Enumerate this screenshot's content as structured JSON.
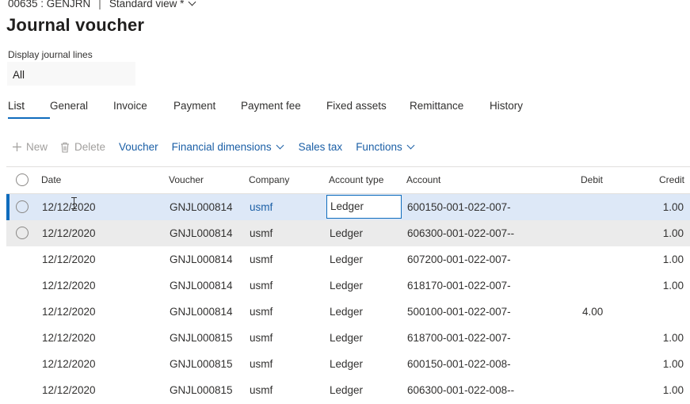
{
  "header": {
    "record": "00635 : GENJRN",
    "separator": "|",
    "view_label": "Standard view *",
    "title": "Journal voucher"
  },
  "filter": {
    "label": "Display journal lines",
    "value": "All"
  },
  "tabs": [
    {
      "label": "List",
      "active": true
    },
    {
      "label": "General"
    },
    {
      "label": "Invoice"
    },
    {
      "label": "Payment"
    },
    {
      "label": "Payment fee"
    },
    {
      "label": "Fixed assets"
    },
    {
      "label": "Remittance"
    },
    {
      "label": "History"
    }
  ],
  "toolbar": {
    "new_label": "New",
    "delete_label": "Delete",
    "voucher_label": "Voucher",
    "financial_dimensions_label": "Financial dimensions",
    "sales_tax_label": "Sales tax",
    "functions_label": "Functions"
  },
  "grid": {
    "columns": {
      "date": "Date",
      "voucher": "Voucher",
      "company": "Company",
      "account_type": "Account type",
      "account": "Account",
      "debit": "Debit",
      "credit": "Credit"
    },
    "rows": [
      {
        "date": "12/12/2020",
        "voucher": "GNJL000814",
        "company": "usmf",
        "account_type": "Ledger",
        "account": "600150-001-022-007-",
        "debit": "",
        "credit": "1.00"
      },
      {
        "date": "12/12/2020",
        "voucher": "GNJL000814",
        "company": "usmf",
        "account_type": "Ledger",
        "account": "606300-001-022-007--",
        "debit": "",
        "credit": "1.00"
      },
      {
        "date": "12/12/2020",
        "voucher": "GNJL000814",
        "company": "usmf",
        "account_type": "Ledger",
        "account": "607200-001-022-007-",
        "debit": "",
        "credit": "1.00"
      },
      {
        "date": "12/12/2020",
        "voucher": "GNJL000814",
        "company": "usmf",
        "account_type": "Ledger",
        "account": "618170-001-022-007-",
        "debit": "",
        "credit": "1.00"
      },
      {
        "date": "12/12/2020",
        "voucher": "GNJL000814",
        "company": "usmf",
        "account_type": "Ledger",
        "account": "500100-001-022-007-",
        "debit": "4.00",
        "credit": ""
      },
      {
        "date": "12/12/2020",
        "voucher": "GNJL000815",
        "company": "usmf",
        "account_type": "Ledger",
        "account": "618700-001-022-007-",
        "debit": "",
        "credit": "1.00"
      },
      {
        "date": "12/12/2020",
        "voucher": "GNJL000815",
        "company": "usmf",
        "account_type": "Ledger",
        "account": "600150-001-022-008-",
        "debit": "",
        "credit": "1.00"
      },
      {
        "date": "12/12/2020",
        "voucher": "GNJL000815",
        "company": "usmf",
        "account_type": "Ledger",
        "account": "606300-001-022-008--",
        "debit": "",
        "credit": "1.00"
      }
    ]
  },
  "colors": {
    "accent": "#0f6cbd",
    "link": "#1b5fa6",
    "selected_row": "#dde8f7",
    "hover_row": "#ebebeb"
  },
  "icons": {
    "new": "plus-icon",
    "delete": "trash-icon",
    "dropdown": "chevron-down-icon",
    "row_select": "radio-icon"
  }
}
